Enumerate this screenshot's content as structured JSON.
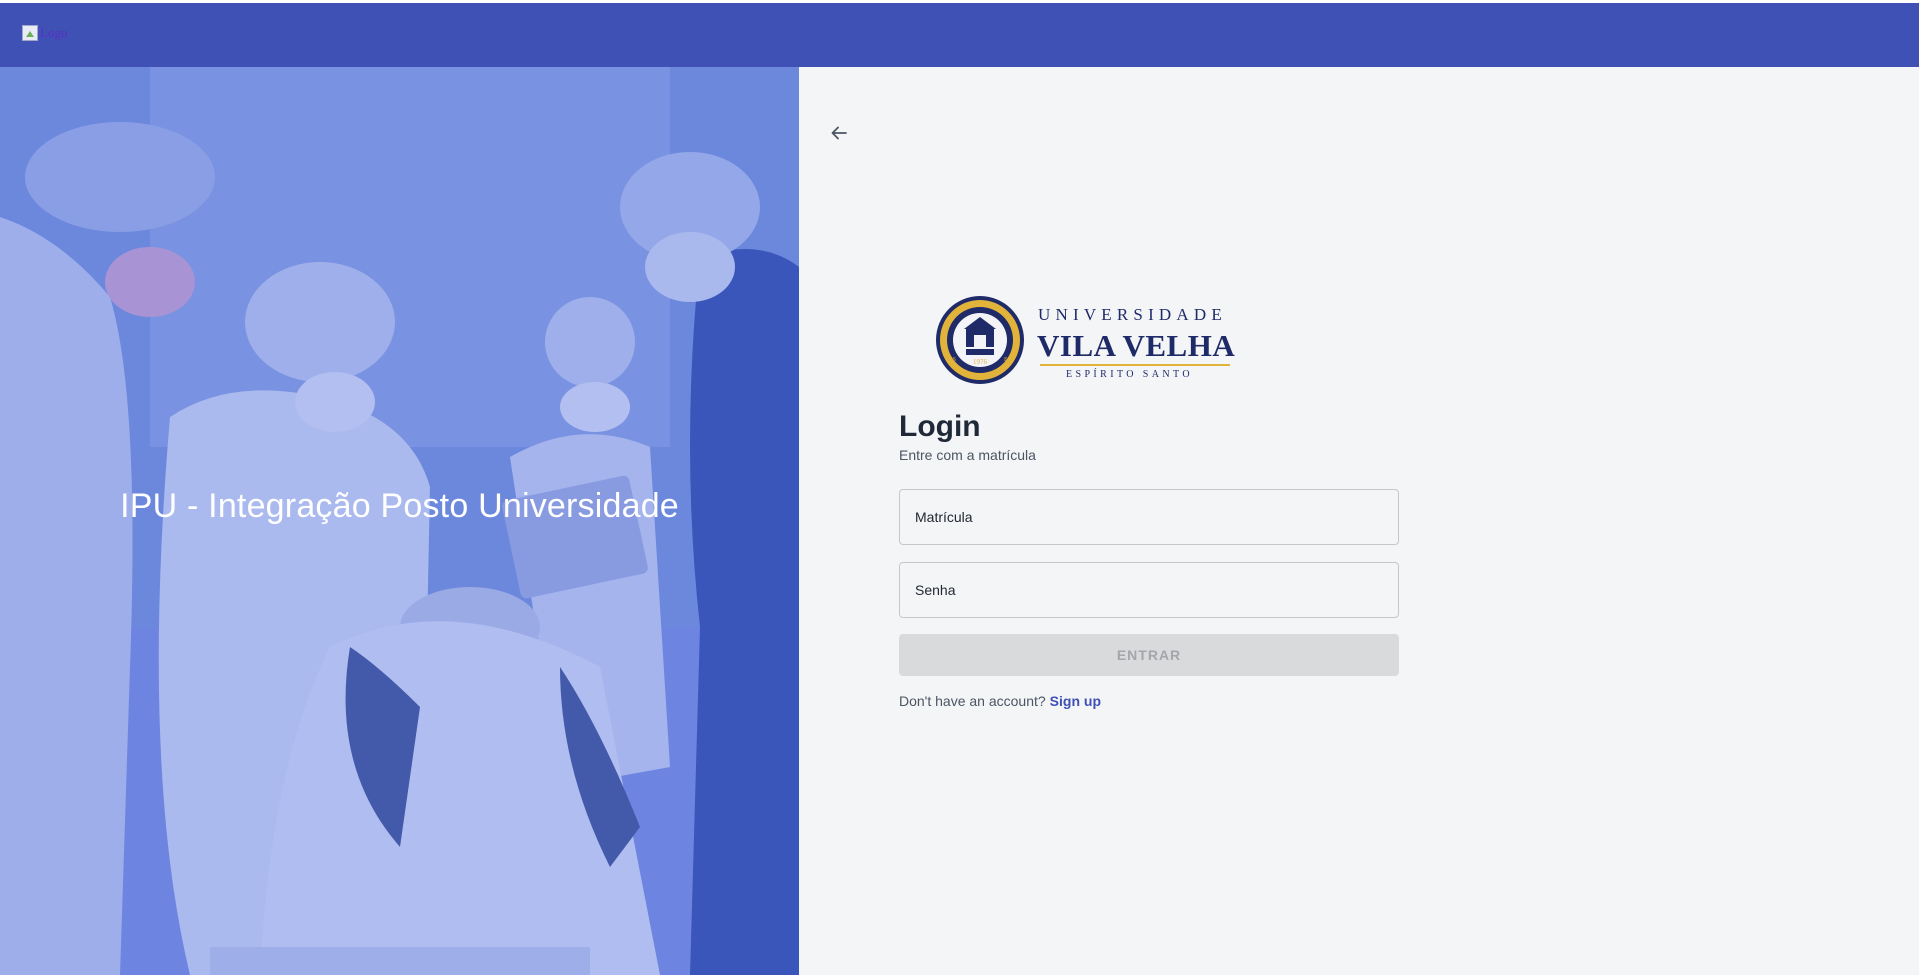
{
  "app_bar": {
    "logo_alt": "Logo",
    "color": "#3f51b5"
  },
  "hero": {
    "title": "IPU - Integração Posto Universidade",
    "image_description": "dental students in masks and caps treating a patient, blue tinted",
    "tint_color": "#5b78d8"
  },
  "university_logo": {
    "line1": "UNIVERSIDADE",
    "line2": "VILA VELHA",
    "line3": "ESPÍRITO SANTO",
    "seal_text": "UNIVERSIDADE VILA VELHA",
    "seal_year": "1976",
    "seal_left": "ES",
    "seal_right": "ES"
  },
  "login": {
    "title": "Login",
    "subtitle": "Entre com a matrícula",
    "matricula_placeholder": "Matrícula",
    "senha_placeholder": "Senha",
    "submit_label": "ENTRAR",
    "signup_prompt": "Don't have an account?",
    "signup_link": "Sign up"
  },
  "colors": {
    "primary": "#3f51b5",
    "panel_bg": "#f4f5f7",
    "button_disabled_bg": "#d9dadc",
    "button_disabled_text": "#a3a6ab"
  },
  "icons": {
    "back": "arrow-left-icon",
    "broken_image": "broken-image-icon"
  }
}
